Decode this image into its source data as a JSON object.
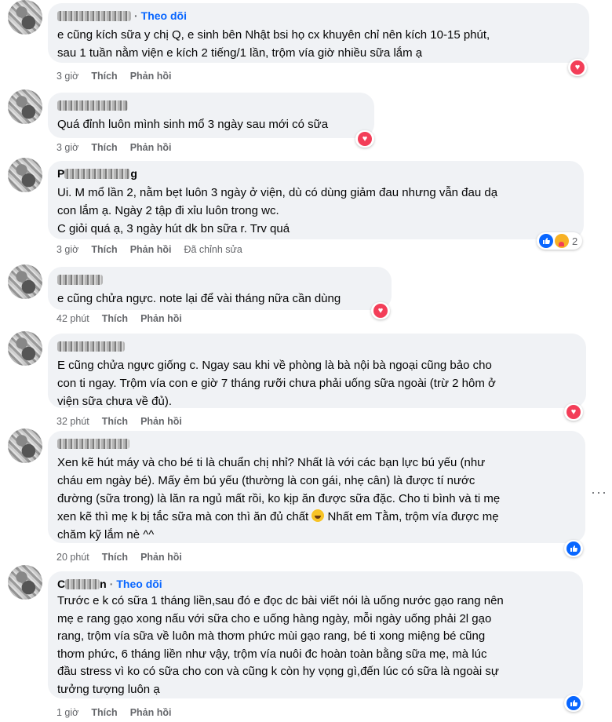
{
  "comments": [
    {
      "name_prefix": "",
      "name_suffix": "",
      "follow": "Theo dõi",
      "lines": [
        "e cũng kích sữa y chị Q, e sinh bên Nhật bsi họ cx khuyên chỉ nên kích 10-15 phút,",
        "sau 1 tuần nằm viện e kích 2 tiếng/1 lần, trộm vía giờ nhiều sữa lắm ạ"
      ],
      "time": "3 giờ",
      "like": "Thích",
      "reply": "Phản hồi",
      "edited": "",
      "reaction_count": ""
    },
    {
      "name_prefix": "",
      "name_suffix": "",
      "follow": "",
      "lines": [
        "Quá đỉnh luôn mình sinh mổ 3 ngày sau mới có sữa"
      ],
      "time": "3 giờ",
      "like": "Thích",
      "reply": "Phản hồi",
      "edited": "",
      "reaction_count": ""
    },
    {
      "name_prefix": "P",
      "name_suffix": "g",
      "follow": "",
      "lines": [
        "Ui. M mổ lần 2, nằm bẹt luôn 3 ngày ở viện, dù có dùng giảm đau nhưng vẫn đau dạ",
        "con lắm ạ. Ngày 2 tập đi xỉu luôn trong wc.",
        "C giỏi quá ạ, 3 ngày hút dk bn sữa r. Trv quá"
      ],
      "time": "3 giờ",
      "like": "Thích",
      "reply": "Phản hồi",
      "edited": "Đã chỉnh sửa",
      "reaction_count": "2"
    },
    {
      "name_prefix": "",
      "name_suffix": "",
      "follow": "",
      "lines": [
        "e cũng chửa ngực. note lại để vài tháng nữa cần dùng"
      ],
      "time": "42 phút",
      "like": "Thích",
      "reply": "Phản hồi",
      "edited": "",
      "reaction_count": ""
    },
    {
      "name_prefix": "",
      "name_suffix": "",
      "follow": "",
      "lines": [
        "E cũng chửa ngực giống c. Ngay sau khi về phòng là bà nội bà ngoại cũng bảo cho",
        "con ti ngay. Trộm vía con e giờ 7 tháng rưỡi chưa phải uống sữa ngoài (trừ 2 hôm ở",
        "viện sữa chưa về đủ)."
      ],
      "time": "32 phút",
      "like": "Thích",
      "reply": "Phản hồi",
      "edited": "",
      "reaction_count": ""
    },
    {
      "name_prefix": "",
      "name_suffix": "",
      "follow": "",
      "lines": [
        "Xen kẽ hút máy và cho bé ti là chuẩn chị nhỉ? Nhất là với các bạn lực bú yếu (như",
        "cháu em ngày bé). Mấy ẻm bú yếu (thường là con gái, nhẹ cân) là được tí nước",
        "đường (sữa trong) là lăn ra ngủ mất rồi, ko kịp ăn được sữa đặc. Cho ti bình và ti mẹ",
        "xen kẽ thì mẹ k bị tắc sữa mà con thì ăn đủ chất",
        "chăm kỹ lắm nè ^^"
      ],
      "line4_tail": " Nhất em Tằm, trộm vía được mẹ",
      "time": "20 phút",
      "like": "Thích",
      "reply": "Phản hồi",
      "edited": "",
      "reaction_count": ""
    },
    {
      "name_prefix": "C",
      "name_suffix": "n",
      "follow": "Theo dõi",
      "lines": [
        "Trước e k có sữa 1 tháng liền,sau đó e đọc dc bài viết nói là uống nước gạo rang nên",
        "mẹ e rang gạo xong nấu với sữa cho e uống hàng ngày, mỗi ngày uống phải 2l gạo",
        "rang, trộm vía sữa về luôn mà thơm phức mùi gạo rang, bé ti xong miệng bé cũng",
        "thơm phức, 6 tháng liền như vậy, trộm vía nuôi đc hoàn toàn bằng sữa mẹ, mà lúc",
        "đầu stress vì ko có sữa cho con và cũng k còn hy vọng gì,đến lúc có sữa là ngoài sự",
        "tưởng tượng luôn ạ"
      ],
      "time": "1 giờ",
      "like": "Thích",
      "reply": "Phản hồi",
      "edited": "",
      "reaction_count": ""
    }
  ],
  "reaction_heart": "♥",
  "colors": {
    "bubble": "#f0f2f5",
    "link": "#0866ff",
    "meta": "#65676b",
    "heart": "#f33e58"
  }
}
